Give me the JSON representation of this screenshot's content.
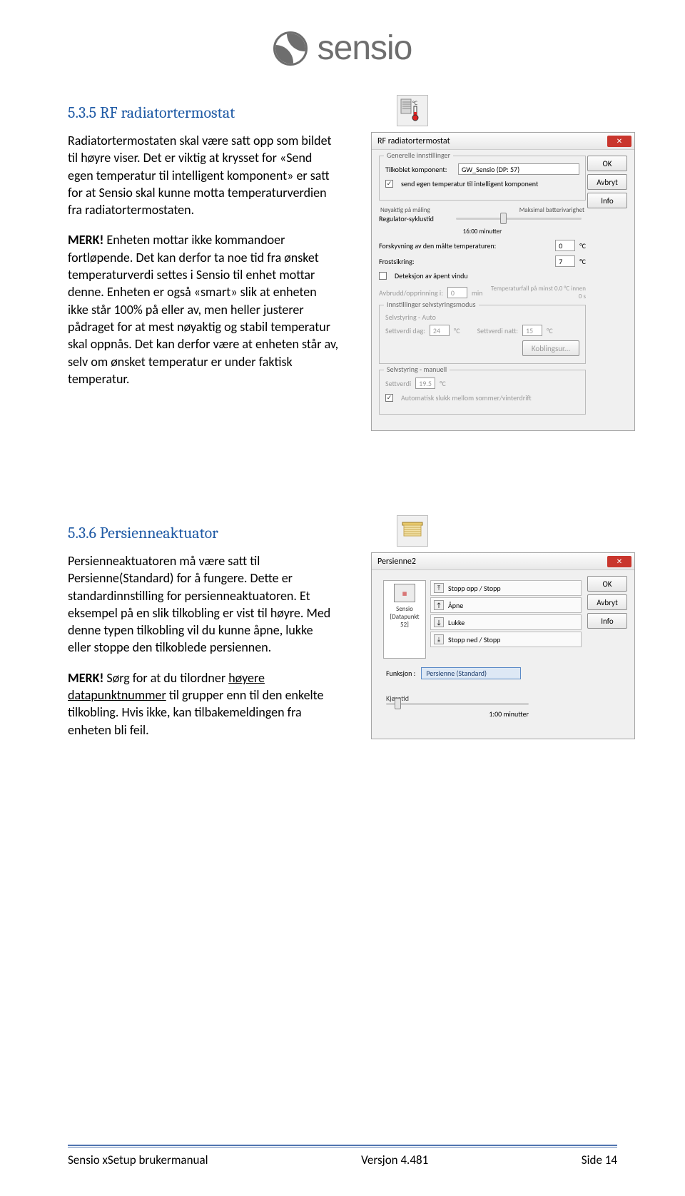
{
  "logo": {
    "text": "sensio"
  },
  "section1": {
    "heading": "5.3.5   RF radiatortermostat",
    "p1": "Radiatortermostaten skal være satt opp som bildet til høyre viser. Det er viktig at krysset for «Send egen temperatur til intelligent komponent» er satt for at Sensio skal kunne motta temperaturverdien fra radiatortermostaten.",
    "merk": "MERK!",
    "p2": " Enheten mottar ikke kommandoer fortløpende. Det kan derfor ta noe tid fra ønsket temperaturverdi settes i Sensio til enhet mottar denne. Enheten er også «smart» slik at enheten ikke står 100% på eller av, men heller justerer pådraget for at mest nøyaktig og stabil temperatur skal oppnås. Det kan derfor være at enheten står av, selv om ønsket temperatur er under faktisk temperatur."
  },
  "section2": {
    "heading": "5.3.6   Persienneaktuator",
    "p1": "Persienneaktuatoren må være satt til Persienne(Standard) for å fungere. Dette er standardinnstilling for persienneaktuatoren. Et eksempel på en slik tilkobling er vist til høyre. Med denne typen tilkobling vil du kunne åpne, lukke eller stoppe den tilkoblede persiennen.",
    "merk": "MERK!",
    "p2_a": " Sørg for at du tilordner ",
    "p2_u": "høyere datapunktnummer",
    "p2_b": " til grupper enn til den enkelte tilkobling. Hvis ikke, kan tilbakemeldingen fra enheten bli feil."
  },
  "dialog1": {
    "title": "RF radiatortermostat",
    "buttons": {
      "ok": "OK",
      "cancel": "Avbryt",
      "info": "Info"
    },
    "grp1": {
      "legend": "Generelle innstillinger",
      "connected_label": "Tilkoblet komponent:",
      "connected_value": "GW_Sensio  (DP: 57)",
      "send_temp": "send egen temperatur til intelligent komponent"
    },
    "sliders": {
      "left_top": "Nøyaktig på måling",
      "right_top": "Maksimal batterivarighet",
      "regsyk": "Regulator-syklustid",
      "regsyk_val": "16:00 minutter",
      "forsky": "Forskyvning av den målte temperaturen:",
      "frost": "Frostsikring:",
      "forsky_val": "0",
      "frost_val": "7",
      "detect": "Deteksjon av åpent vindu",
      "avbrudd": "Avbrudd/opprinning i:",
      "avbrudd_val": "0",
      "avbrudd_unit": "min",
      "tempfall": "Temperaturfall på minst 0.0 °C innen 0 s"
    },
    "grp2": {
      "legend": "Innstillinger selvstyringsmodus",
      "auto": "Selvstyring - Auto",
      "setdag": "Settverdi dag:",
      "setnatt": "Settverdi natt:",
      "setdag_val": "24",
      "setnatt_val": "15",
      "unit": "°C",
      "kobl": "Koblingsur..."
    },
    "grp3": {
      "legend": "Selvstyring - manuell",
      "set": "Settverdi",
      "set_val": "19.5",
      "unit": "°C",
      "autoslukk": "Automatisk slukk mellom sommer/vinterdrift"
    }
  },
  "dialog2": {
    "title": "Persienne2",
    "buttons": {
      "ok": "OK",
      "cancel": "Avbryt",
      "info": "Info"
    },
    "canvas_label1": "Sensio",
    "canvas_label2": "[Datapunkt 52]",
    "actions": {
      "a1": "Stopp opp / Stopp",
      "a2": "Åpne",
      "a3": "Lukke",
      "a4": "Stopp ned / Stopp"
    },
    "func_label": "Funksjon :",
    "func_value": "Persienne (Standard)",
    "kjoretid_label": "Kjøretid",
    "kjoretid_value": "1:00 minutter"
  },
  "footer": {
    "left": "Sensio xSetup brukermanual",
    "center": "Versjon 4.481",
    "right": "Side 14"
  }
}
